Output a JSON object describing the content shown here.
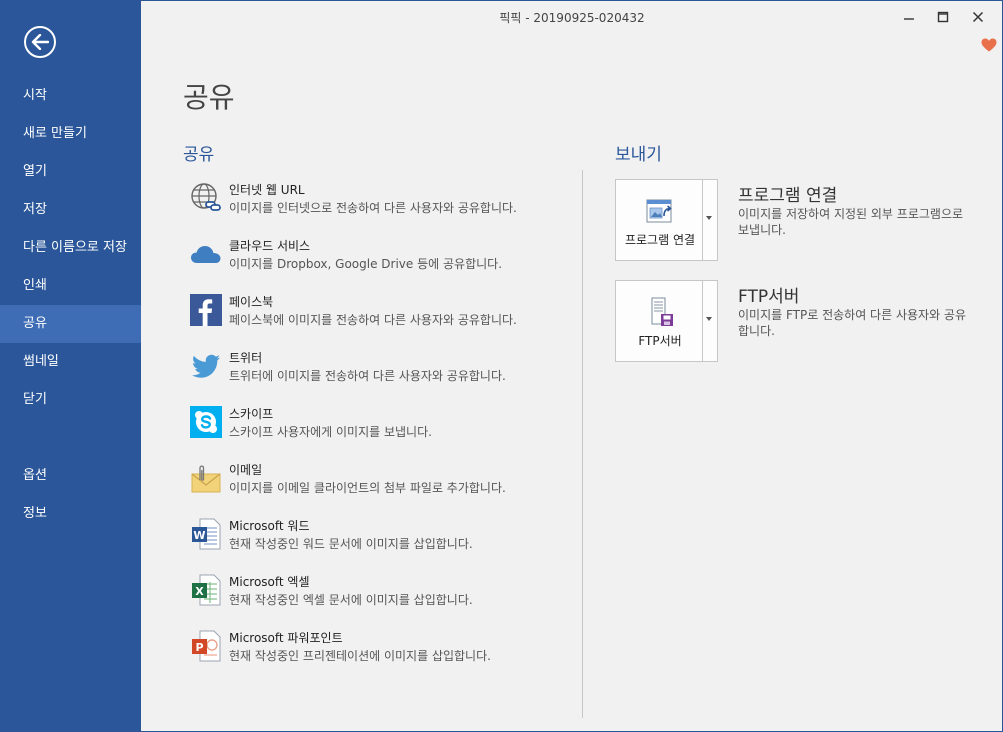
{
  "window": {
    "title": "픽픽 - 20190925-020432"
  },
  "sidebar": {
    "items": [
      {
        "label": "시작"
      },
      {
        "label": "새로 만들기"
      },
      {
        "label": "열기"
      },
      {
        "label": "저장"
      },
      {
        "label": "다른 이름으로 저장"
      },
      {
        "label": "인쇄"
      },
      {
        "label": "공유",
        "active": true
      },
      {
        "label": "썸네일"
      },
      {
        "label": "닫기"
      },
      {
        "label": "옵션"
      },
      {
        "label": "정보"
      }
    ]
  },
  "main": {
    "page_title": "공유",
    "share_section_title": "공유",
    "export_section_title": "보내기",
    "share_items": [
      {
        "name": "인터넷 웹 URL",
        "desc": "이미지를 인터넷으로 전송하여 다른 사용자와 공유합니다.",
        "icon": "globe-link-icon"
      },
      {
        "name": "클라우드 서비스",
        "desc": "이미지를 Dropbox, Google Drive 등에 공유합니다.",
        "icon": "cloud-icon"
      },
      {
        "name": "페이스북",
        "desc": "페이스북에 이미지를 전송하여 다른 사용자와 공유합니다.",
        "icon": "facebook-icon"
      },
      {
        "name": "트위터",
        "desc": "트위터에 이미지를 전송하여 다른 사용자와 공유합니다.",
        "icon": "twitter-icon"
      },
      {
        "name": "스카이프",
        "desc": "스카이프 사용자에게 이미지를 보냅니다.",
        "icon": "skype-icon"
      },
      {
        "name": "이메일",
        "desc": "이미지를 이메일 클라이언트의 첨부 파일로 추가합니다.",
        "icon": "email-icon"
      },
      {
        "name": "Microsoft 워드",
        "desc": "현재 작성중인 워드 문서에 이미지를 삽입합니다.",
        "icon": "word-icon"
      },
      {
        "name": "Microsoft 엑셀",
        "desc": "현재 작성중인 엑셀 문서에 이미지를 삽입합니다.",
        "icon": "excel-icon"
      },
      {
        "name": "Microsoft 파워포인트",
        "desc": "현재 작성중인 프리젠테이션에 이미지를 삽입합니다.",
        "icon": "powerpoint-icon"
      }
    ],
    "export_items": [
      {
        "button_label": "프로그램 연결",
        "title": "프로그램 연결",
        "desc": "이미지를 저장하여 지정된 외부 프로그램으로 보냅니다.",
        "icon": "open-with-program-icon"
      },
      {
        "button_label": "FTP서버",
        "title": "FTP서버",
        "desc": "이미지를 FTP로 전송하여 다른 사용자와 공유합니다.",
        "icon": "ftp-server-icon"
      }
    ]
  },
  "colors": {
    "sidebar_bg": "#2b579a",
    "sidebar_active": "#3e6db5",
    "section_title": "#2b579a",
    "heart": "#e8704a"
  }
}
